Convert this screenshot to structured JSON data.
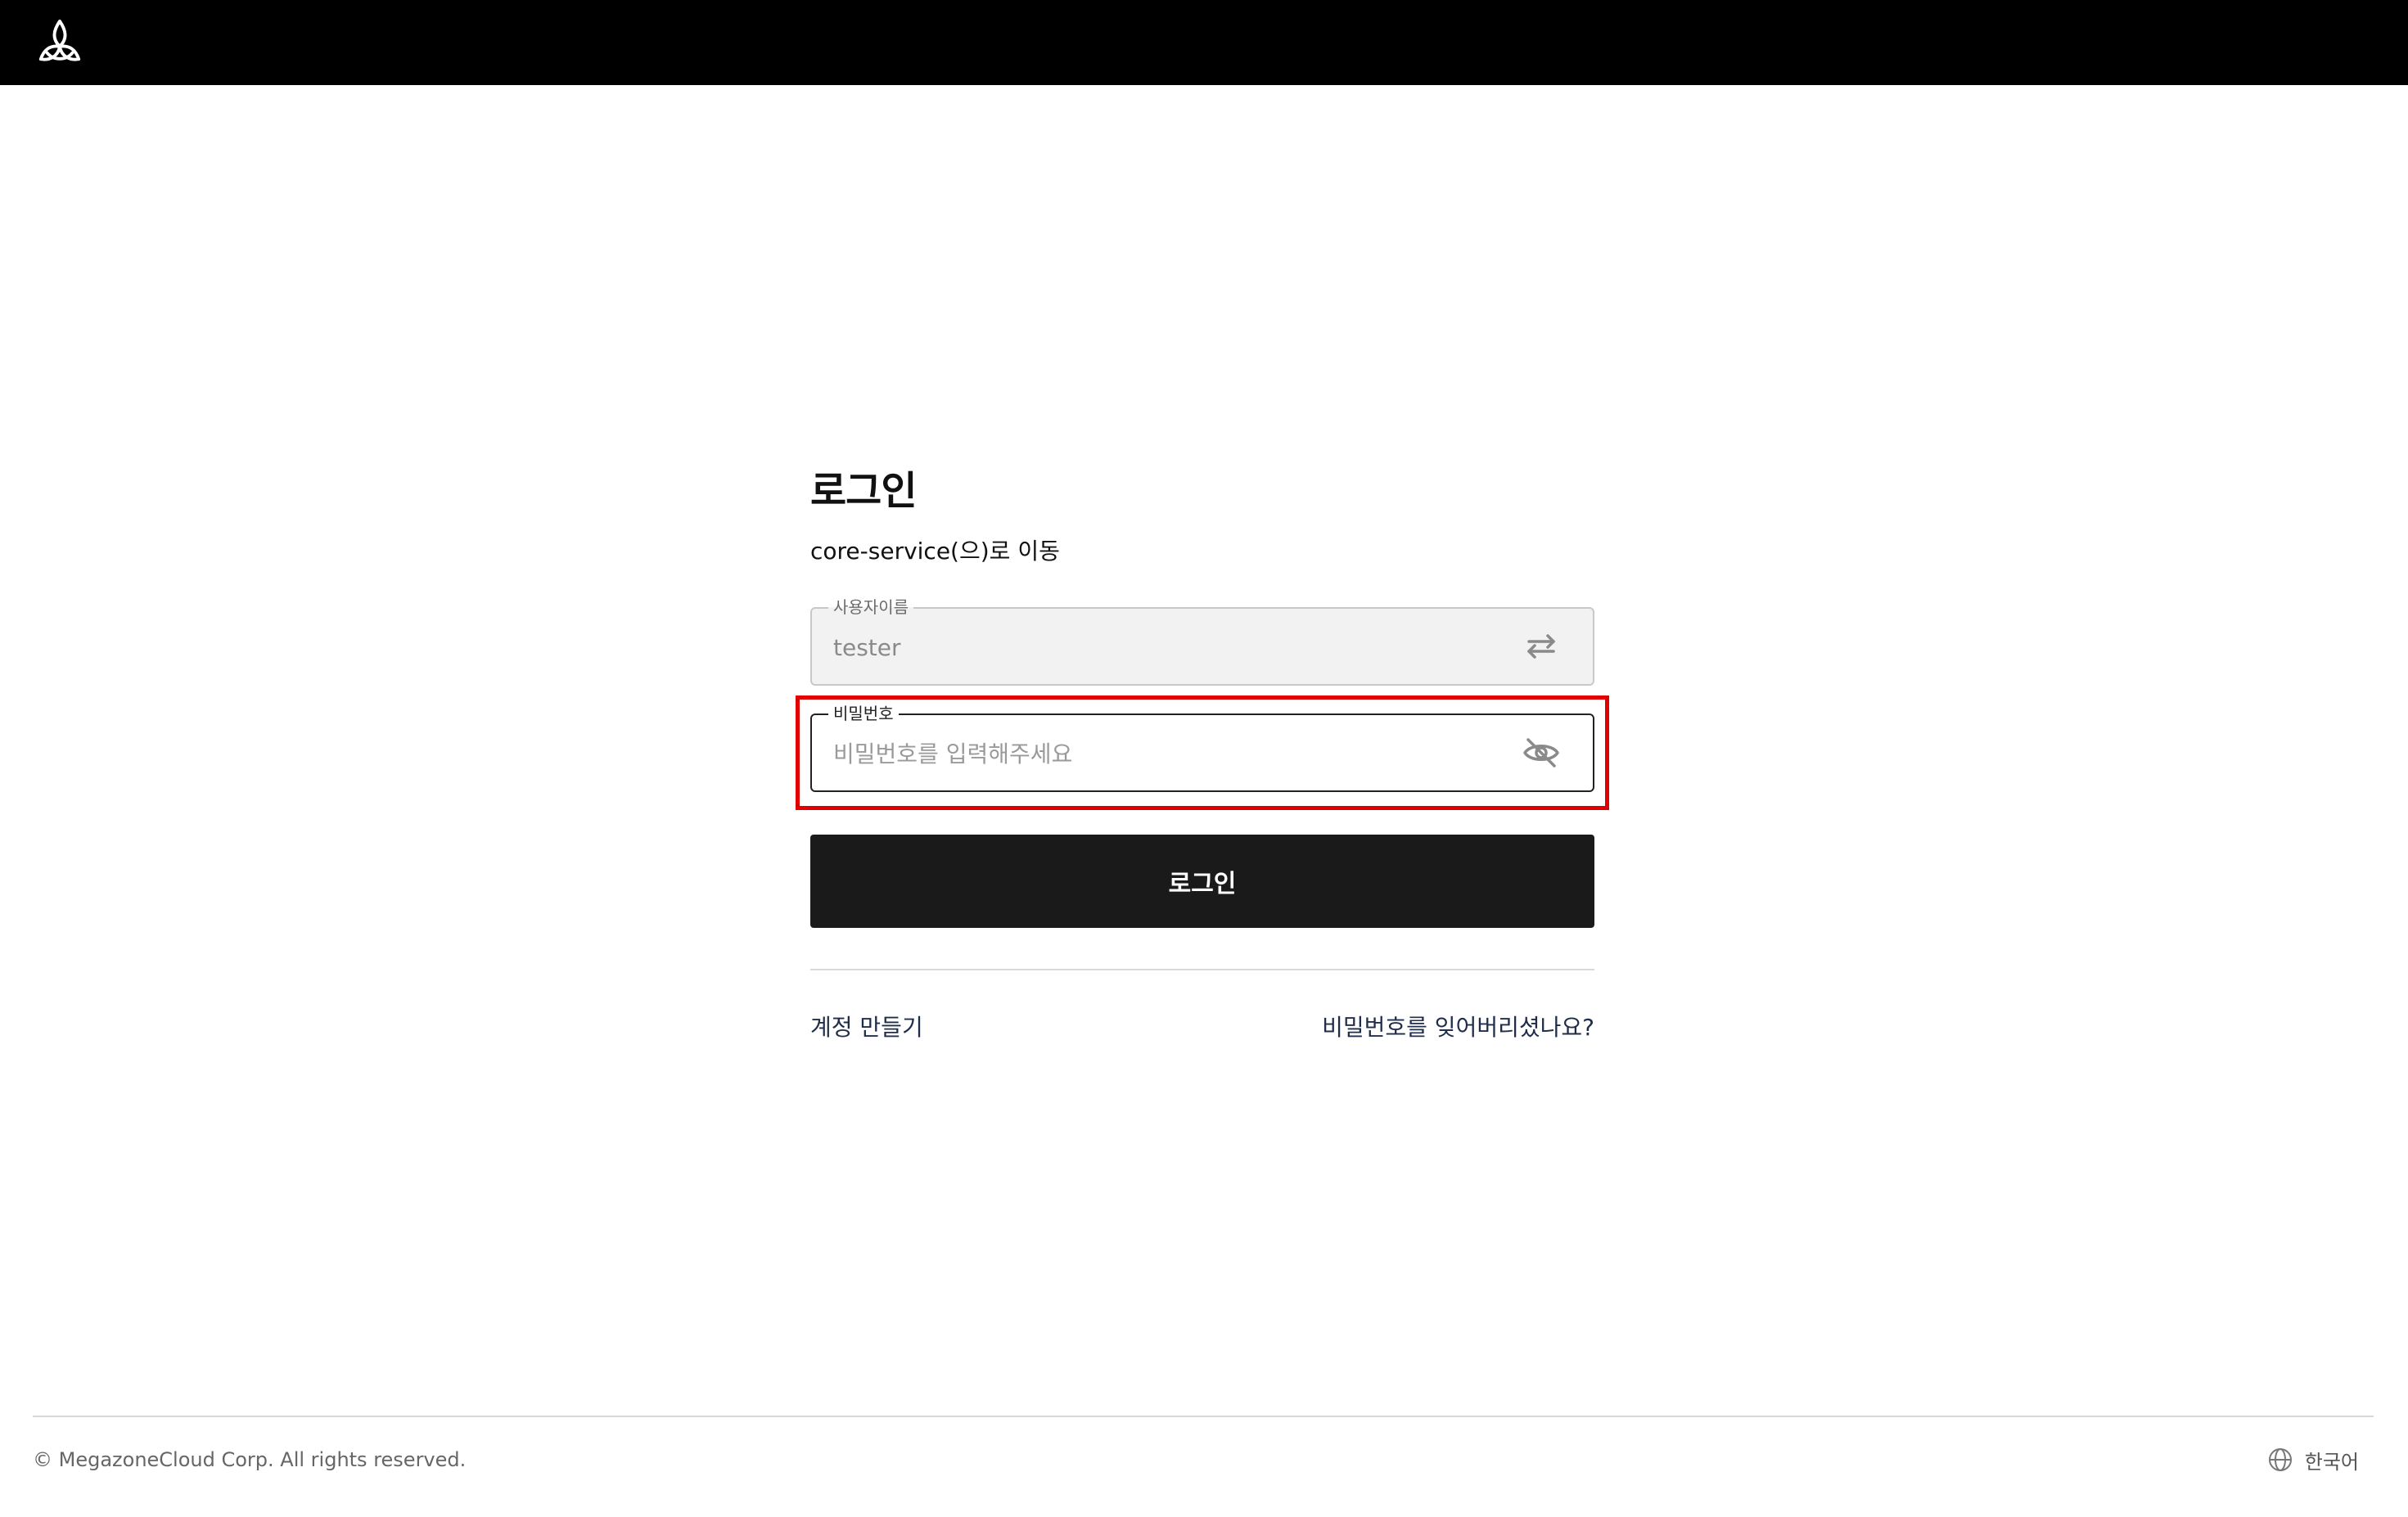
{
  "header": {
    "logo_icon": "triquetra-logo-icon"
  },
  "login": {
    "title": "로그인",
    "subtitle": "core-service(으)로 이동",
    "username": {
      "label": "사용자이름",
      "value": "tester",
      "icon": "swap-arrows-icon"
    },
    "password": {
      "label": "비밀번호",
      "placeholder": "비밀번호를 입력해주세요",
      "value": "",
      "icon": "eye-off-icon"
    },
    "submit_label": "로그인",
    "create_account_link": "계정 만들기",
    "forgot_password_link": "비밀번호를 잊어버리셨나요?"
  },
  "highlight": {
    "color": "#e00000"
  },
  "footer": {
    "copyright": "© MegazoneCloud Corp. All rights reserved.",
    "language_icon": "globe-icon",
    "language_label": "한국어"
  }
}
